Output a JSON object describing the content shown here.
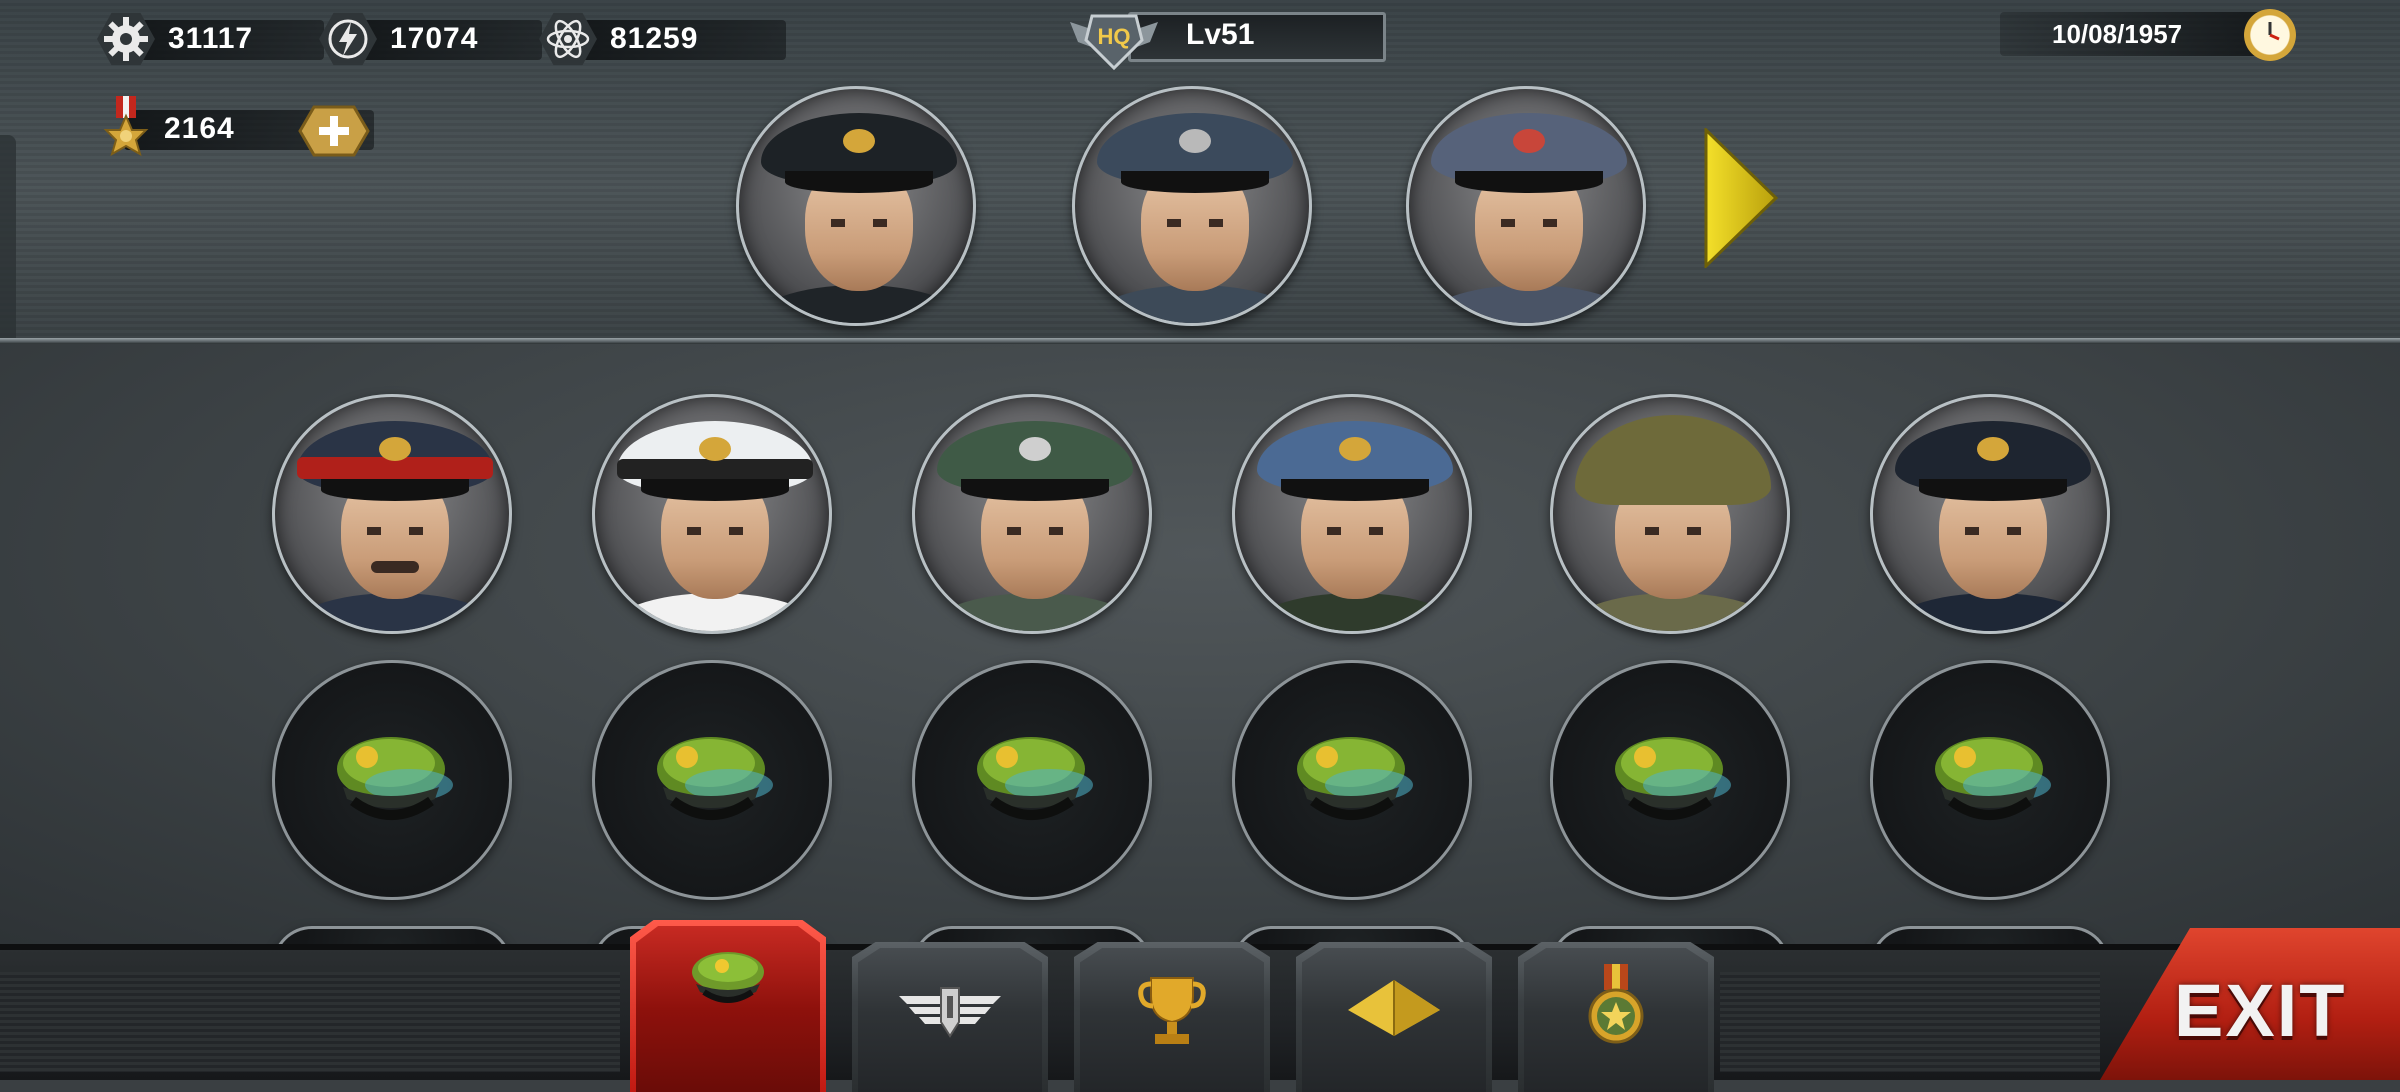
{
  "resources": {
    "parts": {
      "icon": "gear-icon",
      "value": "31117"
    },
    "energy": {
      "icon": "lightning-icon",
      "value": "17074"
    },
    "atom": {
      "icon": "atom-icon",
      "value": "81259"
    },
    "medals": {
      "icon": "medal-icon",
      "value": "2164",
      "add_icon": "plus-icon"
    }
  },
  "hq": {
    "badge": "HQ",
    "level": "Lv51"
  },
  "date": {
    "text": "10/08/1957",
    "icon": "clock-icon"
  },
  "featured_generals": [
    {
      "id": "featured-1",
      "cap_color": "#1d2226",
      "uniform": "#1f2428"
    },
    {
      "id": "featured-2",
      "cap_color": "#3b4a5c",
      "uniform": "#3d4a58"
    },
    {
      "id": "featured-3",
      "cap_color": "#56627a",
      "uniform": "#4a5466"
    }
  ],
  "generals_row1": [
    {
      "id": "general-1",
      "cap_color": "#2a3446",
      "band": "#b0201a",
      "uniform": "#2a3446"
    },
    {
      "id": "general-2",
      "cap_color": "#eceff1",
      "band": "#222",
      "uniform": "#f2f2f2"
    },
    {
      "id": "general-3",
      "cap_color": "#3f5a46",
      "band": "#2c3a30",
      "uniform": "#4a5a4c"
    },
    {
      "id": "general-4",
      "cap_color": "#4b6a94",
      "band": "#2a3a58",
      "uniform": "#2f3b2c"
    },
    {
      "id": "general-5",
      "cap_color": "#6e6a3a",
      "band": "#6e6a3a",
      "uniform": "#6a6a4a"
    },
    {
      "id": "general-6",
      "cap_color": "#1e2530",
      "band": "#141a22",
      "uniform": "#1e2736"
    }
  ],
  "empty_slots": 6,
  "bottom_tabs": [
    {
      "id": "generals",
      "icon": "officer-cap-icon",
      "active": true
    },
    {
      "id": "wings",
      "icon": "wings-icon",
      "active": false
    },
    {
      "id": "trophy",
      "icon": "trophy-icon",
      "active": false
    },
    {
      "id": "pyramid",
      "icon": "pyramid-icon",
      "active": false
    },
    {
      "id": "medal",
      "icon": "medal-star-icon",
      "active": false
    }
  ],
  "exit": {
    "label": "EXIT"
  },
  "colors": {
    "accent_red": "#c11a12",
    "gold": "#d4a63a",
    "nav_arrow": "#e6d21a"
  }
}
